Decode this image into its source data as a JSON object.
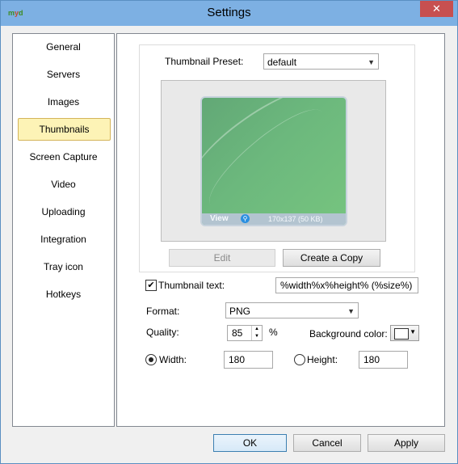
{
  "window": {
    "title": "Settings",
    "close_glyph": "✕"
  },
  "app_icon": {
    "name": "mydl-icon",
    "text_a": "m",
    "text_b": "y",
    "text_c": "d"
  },
  "sidebar": {
    "items": [
      {
        "label": "General"
      },
      {
        "label": "Servers"
      },
      {
        "label": "Images"
      },
      {
        "label": "Thumbnails",
        "selected": true
      },
      {
        "label": "Screen Capture"
      },
      {
        "label": "Video"
      },
      {
        "label": "Uploading"
      },
      {
        "label": "Integration"
      },
      {
        "label": "Tray icon"
      },
      {
        "label": "Hotkeys"
      }
    ]
  },
  "thumbnails": {
    "preset_label": "Thumbnail Preset:",
    "preset_value": "default",
    "preview": {
      "view_label": "View",
      "size_text": "170x137 (50 KB)"
    },
    "edit_label": "Edit",
    "copy_label": "Create a Copy",
    "thumb_text_label": "Thumbnail text:",
    "thumb_text_checked": true,
    "thumb_text_value": "%width%x%height% (%size%)",
    "format_label": "Format:",
    "format_value": "PNG",
    "quality_label": "Quality:",
    "quality_value": "85",
    "quality_unit": "%",
    "bg_color_label": "Background color:",
    "bg_color": "#ffffff",
    "width_label": "Width:",
    "width_value": "180",
    "width_selected": true,
    "height_label": "Height:",
    "height_value": "180",
    "height_selected": false
  },
  "footer": {
    "ok_label": "OK",
    "cancel_label": "Cancel",
    "apply_label": "Apply"
  },
  "colors": {
    "titlebar": "#7db0e3",
    "close": "#c75050",
    "selected_item": "#fdf3b6"
  }
}
